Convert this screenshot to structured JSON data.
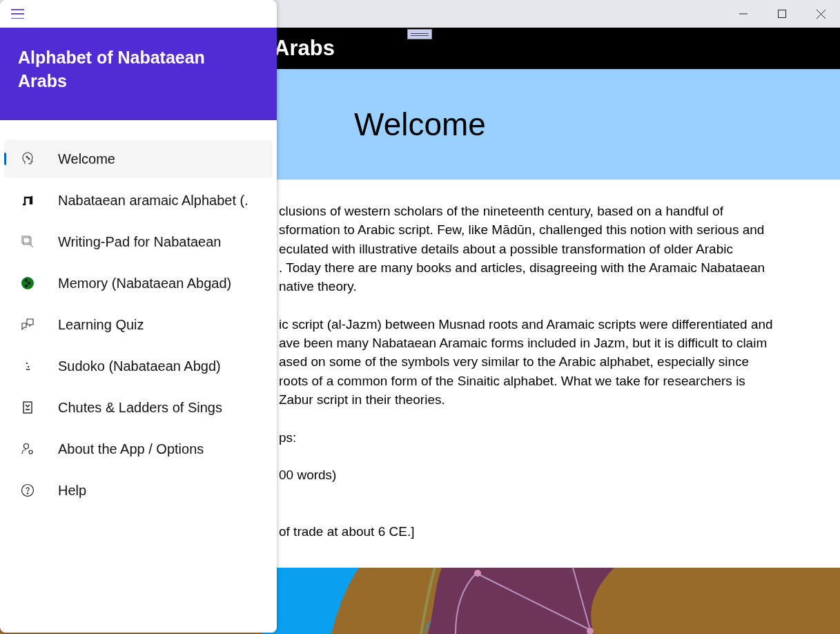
{
  "header": {
    "title": "Arabs"
  },
  "banner": {
    "title": "Welcome"
  },
  "paragraphs": [
    [
      "clusions of western scholars of the nineteenth century, based on a handful of",
      "sformation to Arabic script. Few, like Mādūn, challenged this notion with serious and",
      "eculated with illustrative details about a possible transformation of older Arabic",
      ". Today there are many books and articles, disagreeing with the Aramaic Nabataean",
      "native theory."
    ],
    [
      "ic script (al-Jazm) between Musnad roots and Aramaic scripts were differentiated and",
      "ave been many Nabataean Aramaic forms included in Jazm, but it is difficult to claim",
      "ased on some of the symbols very similar to the Arabic alphabet, especially since",
      "roots of a common form of the Sinaitic alphabet. What we take for researchers is",
      "Zabur script in their theories."
    ],
    [
      "ps:"
    ],
    [
      "00 words)"
    ],
    [
      "of trade at about 6 CE.]"
    ]
  ],
  "drawer": {
    "title": "Alphabet of Nabataean Arabs",
    "items": [
      {
        "label": "Welcome",
        "selected": true
      },
      {
        "label": "Nabataean aramaic Alphabet (.",
        "selected": false
      },
      {
        "label": "Writing-Pad for Nabataean",
        "selected": false
      },
      {
        "label": "Memory (Nabataean Abgad)",
        "selected": false
      },
      {
        "label": "Learning Quiz",
        "selected": false
      },
      {
        "label": "Sudoko (Nabataean Abgd)",
        "selected": false
      },
      {
        "label": "Chutes & Ladders of Sings",
        "selected": false
      },
      {
        "label": "About the App / Options",
        "selected": false
      },
      {
        "label": "Help",
        "selected": false
      }
    ]
  }
}
